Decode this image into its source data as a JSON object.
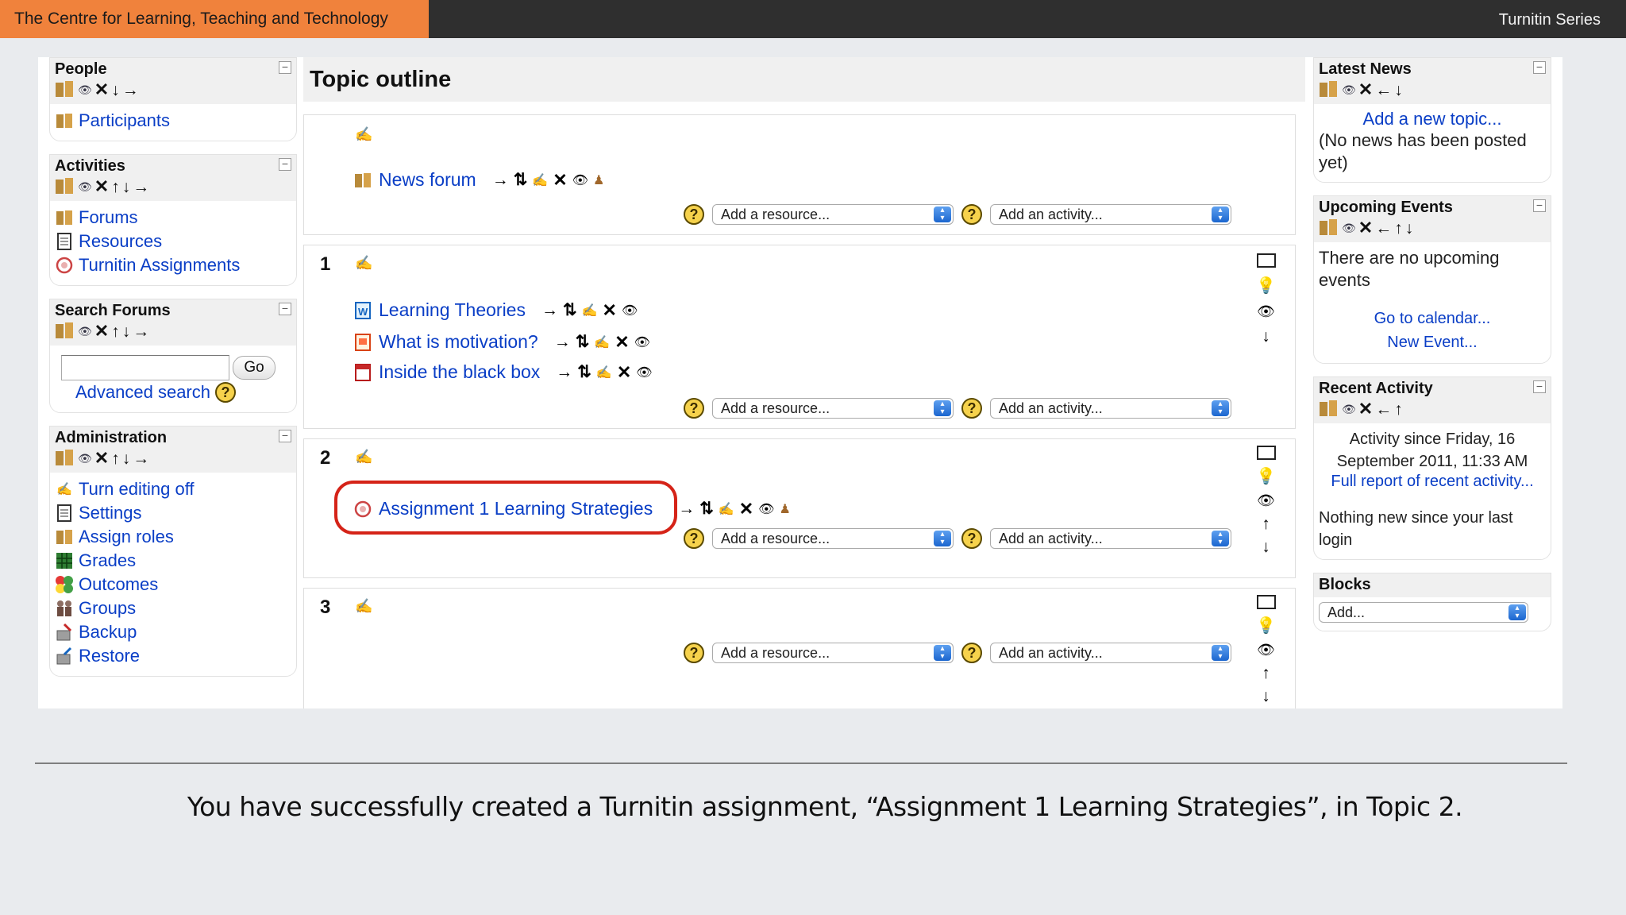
{
  "header": {
    "brand": "The Centre for Learning, Teaching and Technology",
    "series": "Turnitin Series",
    "brand_color": "#f0823c",
    "bar_color": "#2f2f2f"
  },
  "left": {
    "people": {
      "title": "People",
      "items": [
        {
          "label": "Participants",
          "icon": "people-icon"
        }
      ]
    },
    "activities": {
      "title": "Activities",
      "items": [
        {
          "label": "Forums",
          "icon": "forum-icon"
        },
        {
          "label": "Resources",
          "icon": "resource-icon"
        },
        {
          "label": "Turnitin Assignments",
          "icon": "turnitin-icon"
        }
      ]
    },
    "search": {
      "title": "Search Forums",
      "go": "Go",
      "advanced": "Advanced search"
    },
    "admin": {
      "title": "Administration",
      "items": [
        {
          "label": "Turn editing off"
        },
        {
          "label": "Settings"
        },
        {
          "label": "Assign roles"
        },
        {
          "label": "Grades"
        },
        {
          "label": "Outcomes"
        },
        {
          "label": "Groups"
        },
        {
          "label": "Backup"
        },
        {
          "label": "Restore"
        }
      ]
    }
  },
  "main": {
    "title": "Topic outline",
    "add_resource": "Add a resource...",
    "add_activity": "Add an activity...",
    "section0": {
      "items": [
        "News forum"
      ]
    },
    "section1": {
      "number": "1",
      "items": [
        "Learning Theories",
        "What is motivation?",
        "Inside the black box"
      ]
    },
    "section2": {
      "number": "2",
      "items": [
        "Assignment 1 Learning Strategies"
      ]
    },
    "section3": {
      "number": "3"
    }
  },
  "right": {
    "news": {
      "title": "Latest News",
      "add": "Add a new topic...",
      "empty": "(No news has been posted yet)"
    },
    "events": {
      "title": "Upcoming Events",
      "empty": "There are no upcoming events",
      "calendar": "Go to calendar...",
      "new": "New Event..."
    },
    "recent": {
      "title": "Recent Activity",
      "since": "Activity since Friday, 16 September 2011, 11:33 AM",
      "full": "Full report of recent activity...",
      "nothing": "Nothing new since your last login"
    },
    "blocks": {
      "title": "Blocks",
      "add": "Add..."
    }
  },
  "caption": "You have successfully created a Turnitin assignment, “Assignment 1 Learning Strategies”, in Topic 2."
}
